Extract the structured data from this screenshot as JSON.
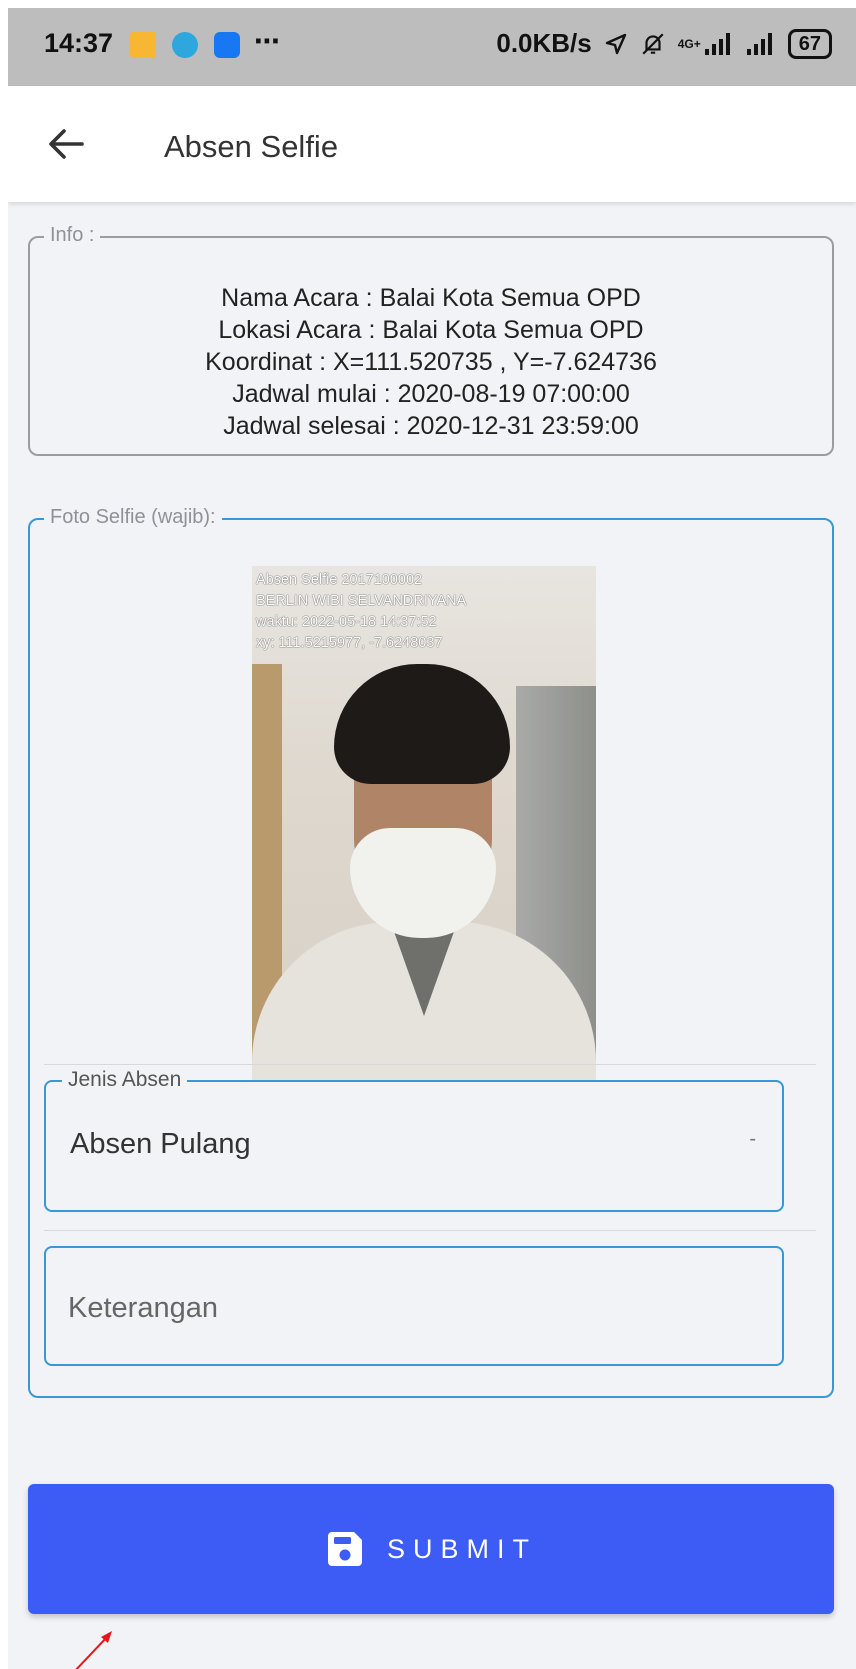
{
  "status_bar": {
    "time": "14:37",
    "more": "⋯",
    "net_speed": "0.0KB/s",
    "signal_label": "4G+",
    "battery": "67"
  },
  "app_bar": {
    "title": "Absen Selfie",
    "back_icon": "arrow-left-icon"
  },
  "info": {
    "legend": "Info :",
    "lines": [
      "Nama Acara : Balai Kota Semua OPD",
      "Lokasi Acara : Balai Kota Semua OPD",
      "Koordinat : X=111.520735 , Y=-7.624736",
      "Jadwal mulai : 2020-08-19 07:00:00",
      "Jadwal selesai : 2020-12-31 23:59:00"
    ]
  },
  "foto": {
    "legend": "Foto Selfie (wajib):",
    "overlay_lines": [
      "Absen Selfie 2017100002",
      "BERLIN WIBI SELVANDRIYANA",
      "waktu: 2022-05-18 14:37:52",
      "xy: 111.5215977, -7.6248037"
    ]
  },
  "jenis_absen": {
    "legend": "Jenis Absen",
    "value": "Absen Pulang",
    "caret": "-"
  },
  "keterangan": {
    "placeholder": "Keterangan"
  },
  "submit": {
    "label": "SUBMIT",
    "icon": "save-icon"
  },
  "colors": {
    "accent_blue": "#3d5cf5",
    "border_blue": "#3797d8",
    "status_bar": "#bdbdbd",
    "annotation_red": "#e8161b"
  }
}
